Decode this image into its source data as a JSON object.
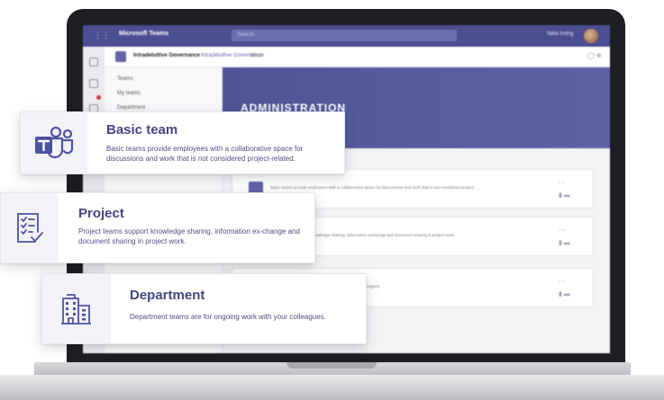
{
  "teams_app": {
    "app_name": "Microsoft Teams",
    "search_placeholder": "Search",
    "user_name": "Nikki Irving",
    "team_name": "Intradeluttive Governance",
    "tabs": [
      "Intradeluttive Governance",
      "Moon"
    ],
    "channels": [
      "Teams",
      "My teams",
      "Department"
    ],
    "banner_title": "ADMINISTRATION",
    "rows": [
      "Basic teams provide employees with a collaborative space for discussions and work that is not considered project.",
      "Project teams support knowledge sharing, information exchange and document sharing in project work.",
      "Department teams are for ongoing work with your colleagues."
    ]
  },
  "cards": {
    "basic": {
      "title": "Basic team",
      "description": "Basic teams provide employees with a collaborative space for discussions and work that is not considered project-related.",
      "icon": "teams-logo-icon"
    },
    "project": {
      "title": "Project",
      "description": "Project teams support knowledge sharing, information ex-change and document sharing in project work.",
      "icon": "checklist-icon"
    },
    "department": {
      "title": "Department",
      "description": "Department teams are for ongoing work with your colleagues.",
      "icon": "building-icon"
    }
  },
  "colors": {
    "accent": "#4b4f91",
    "card_title": "#43467f",
    "icon_purple": "#4d52a0"
  }
}
